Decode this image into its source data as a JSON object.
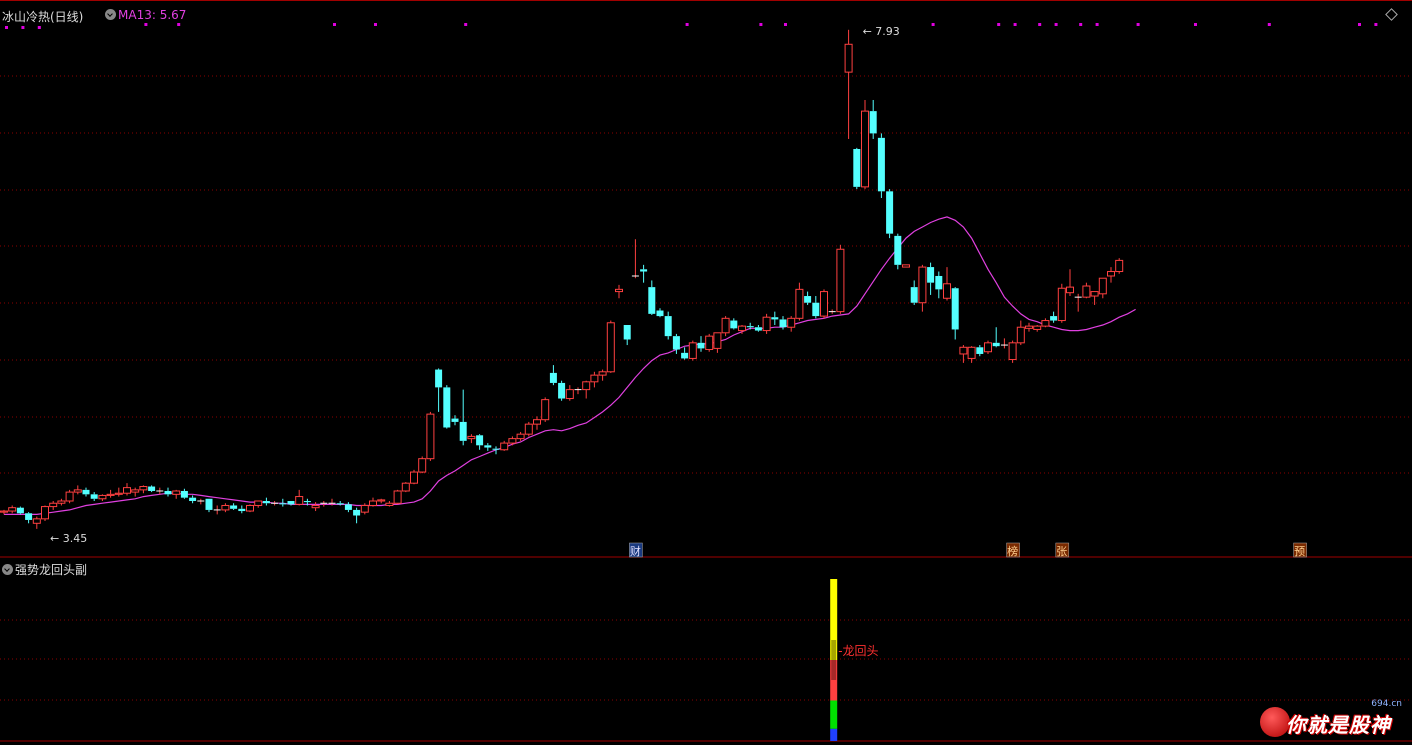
{
  "header": {
    "title": "冰山冷热(日线)",
    "ma_label": "MA13: 5.67",
    "sub_title": "强势龙回头副"
  },
  "icons": {
    "main_menu": "chevron-down-circle-icon",
    "ma_menu": "chevron-down-circle-icon",
    "sub_menu": "chevron-down-circle-icon",
    "corner": "diamond-icon"
  },
  "colors": {
    "up_candle": "#ff4040",
    "down_candle": "#54ffff",
    "ma_line": "#e040e0",
    "grid": "#8b0000",
    "signal_dot": "#e000e0",
    "annotation": "#ff3030"
  },
  "chart_data": {
    "type": "candlestick",
    "title": "冰山冷热(日线)",
    "series_ma": {
      "name": "MA13",
      "last_value": 5.67
    },
    "candles": [
      [
        3.6,
        3.62,
        3.58,
        3.61
      ],
      [
        3.61,
        3.66,
        3.59,
        3.64
      ],
      [
        3.64,
        3.65,
        3.58,
        3.59
      ],
      [
        3.59,
        3.6,
        3.5,
        3.53
      ],
      [
        3.5,
        3.56,
        3.45,
        3.54
      ],
      [
        3.54,
        3.66,
        3.52,
        3.65
      ],
      [
        3.65,
        3.7,
        3.62,
        3.68
      ],
      [
        3.68,
        3.72,
        3.66,
        3.7
      ],
      [
        3.7,
        3.8,
        3.68,
        3.78
      ],
      [
        3.78,
        3.84,
        3.76,
        3.8
      ],
      [
        3.8,
        3.82,
        3.74,
        3.76
      ],
      [
        3.76,
        3.78,
        3.7,
        3.72
      ],
      [
        3.72,
        3.76,
        3.7,
        3.75
      ],
      [
        3.75,
        3.8,
        3.73,
        3.76
      ],
      [
        3.76,
        3.82,
        3.74,
        3.77
      ],
      [
        3.77,
        3.86,
        3.75,
        3.82
      ],
      [
        3.78,
        3.82,
        3.74,
        3.8
      ],
      [
        3.8,
        3.84,
        3.77,
        3.83
      ],
      [
        3.83,
        3.84,
        3.78,
        3.79
      ],
      [
        3.79,
        3.82,
        3.76,
        3.79
      ],
      [
        3.79,
        3.82,
        3.74,
        3.76
      ],
      [
        3.76,
        3.8,
        3.72,
        3.79
      ],
      [
        3.79,
        3.81,
        3.72,
        3.73
      ],
      [
        3.73,
        3.75,
        3.68,
        3.7
      ],
      [
        3.7,
        3.72,
        3.67,
        3.7
      ],
      [
        3.72,
        3.72,
        3.6,
        3.62
      ],
      [
        3.62,
        3.66,
        3.58,
        3.62
      ],
      [
        3.62,
        3.68,
        3.6,
        3.66
      ],
      [
        3.66,
        3.68,
        3.62,
        3.63
      ],
      [
        3.63,
        3.66,
        3.59,
        3.61
      ],
      [
        3.61,
        3.67,
        3.6,
        3.66
      ],
      [
        3.66,
        3.7,
        3.64,
        3.7
      ],
      [
        3.7,
        3.73,
        3.66,
        3.68
      ],
      [
        3.68,
        3.7,
        3.66,
        3.68
      ],
      [
        3.68,
        3.72,
        3.65,
        3.67
      ],
      [
        3.7,
        3.7,
        3.66,
        3.67
      ],
      [
        3.67,
        3.8,
        3.66,
        3.74
      ],
      [
        3.7,
        3.72,
        3.66,
        3.69
      ],
      [
        3.64,
        3.69,
        3.61,
        3.66
      ],
      [
        3.68,
        3.7,
        3.65,
        3.68
      ],
      [
        3.68,
        3.72,
        3.66,
        3.68
      ],
      [
        3.68,
        3.7,
        3.66,
        3.67
      ],
      [
        3.67,
        3.69,
        3.6,
        3.62
      ],
      [
        3.62,
        3.64,
        3.5,
        3.57
      ],
      [
        3.6,
        3.68,
        3.58,
        3.66
      ],
      [
        3.66,
        3.73,
        3.65,
        3.7
      ],
      [
        3.7,
        3.72,
        3.68,
        3.71
      ],
      [
        3.66,
        3.7,
        3.65,
        3.68
      ],
      [
        3.68,
        3.8,
        3.67,
        3.79
      ],
      [
        3.79,
        3.87,
        3.78,
        3.86
      ],
      [
        3.86,
        3.98,
        3.85,
        3.96
      ],
      [
        3.96,
        4.1,
        3.95,
        4.08
      ],
      [
        4.08,
        4.5,
        4.06,
        4.48
      ],
      [
        4.88,
        4.89,
        4.5,
        4.72
      ],
      [
        4.72,
        4.74,
        4.35,
        4.36
      ],
      [
        4.44,
        4.47,
        4.38,
        4.41
      ],
      [
        4.41,
        4.7,
        4.2,
        4.24
      ],
      [
        4.26,
        4.3,
        4.22,
        4.28
      ],
      [
        4.29,
        4.3,
        4.16,
        4.2
      ],
      [
        4.2,
        4.22,
        4.15,
        4.18
      ],
      [
        4.17,
        4.19,
        4.12,
        4.16
      ],
      [
        4.16,
        4.24,
        4.15,
        4.22
      ],
      [
        4.22,
        4.28,
        4.2,
        4.26
      ],
      [
        4.26,
        4.32,
        4.24,
        4.3
      ],
      [
        4.3,
        4.41,
        4.28,
        4.39
      ],
      [
        4.39,
        4.46,
        4.34,
        4.43
      ],
      [
        4.43,
        4.63,
        4.41,
        4.61
      ],
      [
        4.85,
        4.92,
        4.74,
        4.76
      ],
      [
        4.76,
        4.78,
        4.6,
        4.62
      ],
      [
        4.62,
        4.74,
        4.6,
        4.7
      ],
      [
        4.7,
        4.72,
        4.66,
        4.7
      ],
      [
        4.7,
        4.78,
        4.62,
        4.77
      ],
      [
        4.77,
        4.86,
        4.72,
        4.83
      ],
      [
        4.83,
        4.88,
        4.78,
        4.86
      ],
      [
        4.86,
        5.32,
        4.85,
        5.3
      ],
      [
        5.58,
        5.64,
        5.52,
        5.6
      ],
      [
        5.28,
        5.27,
        5.1,
        5.15
      ],
      [
        5.72,
        6.05,
        5.7,
        5.72
      ],
      [
        5.78,
        5.82,
        5.66,
        5.76
      ],
      [
        5.62,
        5.68,
        5.37,
        5.38
      ],
      [
        5.41,
        5.43,
        5.35,
        5.36
      ],
      [
        5.36,
        5.4,
        5.15,
        5.18
      ],
      [
        5.18,
        5.2,
        5.02,
        5.06
      ],
      [
        5.03,
        5.08,
        4.97,
        4.98
      ],
      [
        4.98,
        5.14,
        4.96,
        5.12
      ],
      [
        5.12,
        5.18,
        5.04,
        5.07
      ],
      [
        5.06,
        5.2,
        5.04,
        5.18
      ],
      [
        5.07,
        5.2,
        5.03,
        5.21
      ],
      [
        5.21,
        5.36,
        5.18,
        5.34
      ],
      [
        5.32,
        5.34,
        5.24,
        5.25
      ],
      [
        5.23,
        5.28,
        5.2,
        5.27
      ],
      [
        5.27,
        5.3,
        5.24,
        5.26
      ],
      [
        5.26,
        5.28,
        5.22,
        5.23
      ],
      [
        5.23,
        5.38,
        5.2,
        5.35
      ],
      [
        5.35,
        5.4,
        5.28,
        5.33
      ],
      [
        5.33,
        5.36,
        5.24,
        5.26
      ],
      [
        5.26,
        5.36,
        5.22,
        5.34
      ],
      [
        5.34,
        5.66,
        5.32,
        5.6
      ],
      [
        5.54,
        5.58,
        5.46,
        5.48
      ],
      [
        5.48,
        5.54,
        5.34,
        5.36
      ],
      [
        5.36,
        5.6,
        5.34,
        5.58
      ],
      [
        5.4,
        5.42,
        5.38,
        5.4
      ],
      [
        5.4,
        6.0,
        5.38,
        5.96
      ],
      [
        7.55,
        7.93,
        6.95,
        7.8
      ],
      [
        6.86,
        6.87,
        6.5,
        6.52
      ],
      [
        6.52,
        7.3,
        6.5,
        7.2
      ],
      [
        7.2,
        7.3,
        6.95,
        7.0
      ],
      [
        6.96,
        7.0,
        6.42,
        6.48
      ],
      [
        6.48,
        6.5,
        6.06,
        6.1
      ],
      [
        6.08,
        6.1,
        5.78,
        5.82
      ],
      [
        5.8,
        5.82,
        5.82,
        5.82
      ],
      [
        5.62,
        5.68,
        5.46,
        5.48
      ],
      [
        5.48,
        5.82,
        5.4,
        5.8
      ],
      [
        5.8,
        5.84,
        5.55,
        5.66
      ],
      [
        5.72,
        5.76,
        5.52,
        5.6
      ],
      [
        5.52,
        5.8,
        5.5,
        5.65
      ],
      [
        5.61,
        5.62,
        5.15,
        5.24
      ],
      [
        5.02,
        5.1,
        4.94,
        5.08
      ],
      [
        4.98,
        5.09,
        4.94,
        5.08
      ],
      [
        5.08,
        5.1,
        5.0,
        5.02
      ],
      [
        5.04,
        5.14,
        5.02,
        5.12
      ],
      [
        5.12,
        5.26,
        5.08,
        5.09
      ],
      [
        5.1,
        5.16,
        5.07,
        5.1
      ],
      [
        4.97,
        5.14,
        4.94,
        5.12
      ],
      [
        5.12,
        5.32,
        5.1,
        5.26
      ],
      [
        5.25,
        5.3,
        5.22,
        5.27
      ],
      [
        5.24,
        5.28,
        5.22,
        5.27
      ],
      [
        5.27,
        5.34,
        5.26,
        5.32
      ],
      [
        5.36,
        5.4,
        5.3,
        5.32
      ],
      [
        5.32,
        5.65,
        5.3,
        5.61
      ],
      [
        5.57,
        5.78,
        5.54,
        5.62
      ],
      [
        5.53,
        5.56,
        5.4,
        5.53
      ],
      [
        5.53,
        5.66,
        5.52,
        5.63
      ],
      [
        5.54,
        5.58,
        5.46,
        5.58
      ],
      [
        5.56,
        5.68,
        5.52,
        5.7
      ],
      [
        5.72,
        5.8,
        5.66,
        5.76
      ],
      [
        5.76,
        5.88,
        5.74,
        5.86
      ]
    ],
    "ma13": [
      3.58,
      3.58,
      3.58,
      3.58,
      3.58,
      3.59,
      3.6,
      3.61,
      3.62,
      3.64,
      3.66,
      3.67,
      3.68,
      3.69,
      3.7,
      3.71,
      3.72,
      3.74,
      3.75,
      3.76,
      3.77,
      3.77,
      3.76,
      3.76,
      3.75,
      3.74,
      3.73,
      3.72,
      3.71,
      3.7,
      3.69,
      3.69,
      3.69,
      3.68,
      3.68,
      3.67,
      3.67,
      3.67,
      3.67,
      3.67,
      3.67,
      3.67,
      3.67,
      3.66,
      3.66,
      3.66,
      3.66,
      3.67,
      3.67,
      3.68,
      3.69,
      3.72,
      3.79,
      3.88,
      3.93,
      3.97,
      4.02,
      4.07,
      4.1,
      4.13,
      4.16,
      4.18,
      4.21,
      4.23,
      4.27,
      4.3,
      4.33,
      4.34,
      4.33,
      4.35,
      4.38,
      4.4,
      4.45,
      4.5,
      4.56,
      4.63,
      4.72,
      4.81,
      4.89,
      4.96,
      5.01,
      5.03,
      5.06,
      5.09,
      5.1,
      5.11,
      5.11,
      5.13,
      5.15,
      5.19,
      5.22,
      5.25,
      5.25,
      5.25,
      5.26,
      5.26,
      5.28,
      5.3,
      5.32,
      5.33,
      5.34,
      5.36,
      5.37,
      5.38,
      5.45,
      5.56,
      5.67,
      5.78,
      5.88,
      5.97,
      6.06,
      6.12,
      6.16,
      6.2,
      6.23,
      6.25,
      6.22,
      6.16,
      6.06,
      5.92,
      5.78,
      5.66,
      5.53,
      5.45,
      5.38,
      5.33,
      5.31,
      5.28,
      5.26,
      5.24,
      5.23,
      5.23,
      5.24,
      5.26,
      5.28,
      5.31,
      5.35,
      5.38,
      5.42
    ],
    "annotations": {
      "high_label": "7.93",
      "low_label": "3.45"
    },
    "event_markers": [
      {
        "index": 77,
        "label": "财"
      },
      {
        "index": 123,
        "label": "榜"
      },
      {
        "index": 129,
        "label": "张"
      },
      {
        "index": 158,
        "label": "预"
      }
    ],
    "signal_dot_indices": [
      0,
      2,
      4,
      17,
      21,
      40,
      45,
      56,
      83,
      92,
      95,
      113,
      121,
      123,
      126,
      128,
      131,
      133,
      138,
      145,
      154,
      165,
      167
    ],
    "subchart": {
      "title": "强势龙回头副",
      "label": "龙回头",
      "bar_index": 101,
      "segments": [
        {
          "color": "#ffff00",
          "from": 4,
          "to": 2
        },
        {
          "color": "#ff4040",
          "from": 2,
          "to": 1
        },
        {
          "color": "#00e000",
          "from": 1,
          "to": 0.3
        },
        {
          "color": "#2040ff",
          "from": 0.3,
          "to": 0
        }
      ]
    },
    "ylim": [
      3.35,
      8.0
    ]
  },
  "watermark": {
    "text": "你就是股神",
    "site": "694.cn"
  }
}
